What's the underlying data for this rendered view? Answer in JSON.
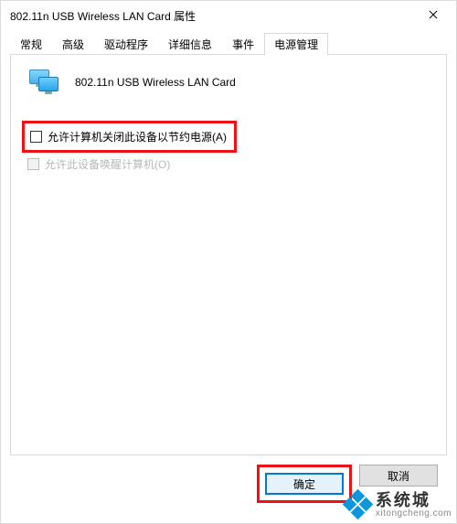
{
  "window": {
    "title": "802.11n USB Wireless LAN Card 属性"
  },
  "tabs": [
    {
      "label": "常规"
    },
    {
      "label": "高级"
    },
    {
      "label": "驱动程序"
    },
    {
      "label": "详细信息"
    },
    {
      "label": "事件"
    },
    {
      "label": "电源管理"
    }
  ],
  "active_tab_index": 5,
  "device": {
    "name": "802.11n USB Wireless LAN Card"
  },
  "options": {
    "allow_turn_off": {
      "label": "允许计算机关闭此设备以节约电源(A)",
      "checked": false,
      "enabled": true
    },
    "allow_wake": {
      "label": "允许此设备唤醒计算机(O)",
      "checked": false,
      "enabled": false
    }
  },
  "buttons": {
    "ok": "确定",
    "cancel": "取消"
  },
  "watermark": {
    "brand": "系统城",
    "url": "xitongcheng.com"
  }
}
